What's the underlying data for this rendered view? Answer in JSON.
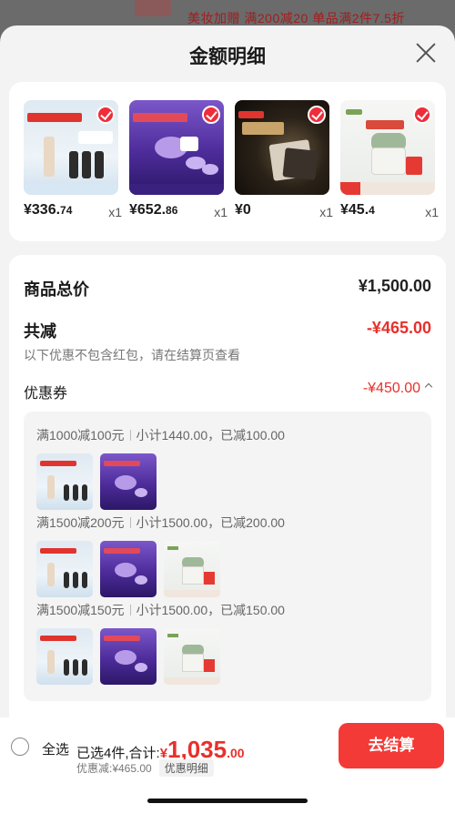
{
  "background": {
    "promo_text": "美妆加赠 满200减20 单品满2件7.5折"
  },
  "sheet": {
    "title": "金额明细"
  },
  "products": [
    {
      "price_int": "¥336.",
      "price_dec": "74",
      "qty": "x1",
      "image": "lancome-foundation-set"
    },
    {
      "price_int": "¥652.",
      "price_dec": "86",
      "qty": "x1",
      "image": "lancome-purple-cream-set"
    },
    {
      "price_int": "¥0",
      "price_dec": "",
      "qty": "x1",
      "image": "dark-mask-set"
    },
    {
      "price_int": "¥45.",
      "price_dec": "4",
      "qty": "x1",
      "image": "white-cream-jar"
    }
  ],
  "summary": {
    "total_label": "商品总价",
    "total_value": "¥1,500.00",
    "reduce_label": "共减",
    "reduce_value": "-¥465.00",
    "reduce_hint": "以下优惠不包含红包，请在结算页查看",
    "coupon_label": "优惠券",
    "coupon_value": "-¥450.00"
  },
  "coupon_groups": [
    {
      "rule": "满1000减100元",
      "detail": "小计1440.00，已减100.00",
      "items": [
        "lancome-foundation-set",
        "lancome-purple-cream-set"
      ]
    },
    {
      "rule": "满1500减200元",
      "detail": "小计1500.00，已减200.00",
      "items": [
        "lancome-foundation-set",
        "lancome-purple-cream-set",
        "white-cream-jar"
      ]
    },
    {
      "rule": "满1500减150元",
      "detail": "小计1500.00，已减150.00",
      "items": [
        "lancome-foundation-set",
        "lancome-purple-cream-set",
        "white-cream-jar"
      ]
    }
  ],
  "bottom": {
    "select_all": "全选",
    "selected_text": "已选4件,合计:",
    "total_symbol": "¥",
    "total_int": "1,035",
    "total_dec": ".00",
    "discount_text": "优惠减:¥465.00",
    "detail_link": "优惠明细",
    "checkout": "去结算"
  },
  "colors": {
    "accent_red": "#e8302b",
    "button_red": "#f33a36",
    "check_red": "#ef2d3a"
  }
}
